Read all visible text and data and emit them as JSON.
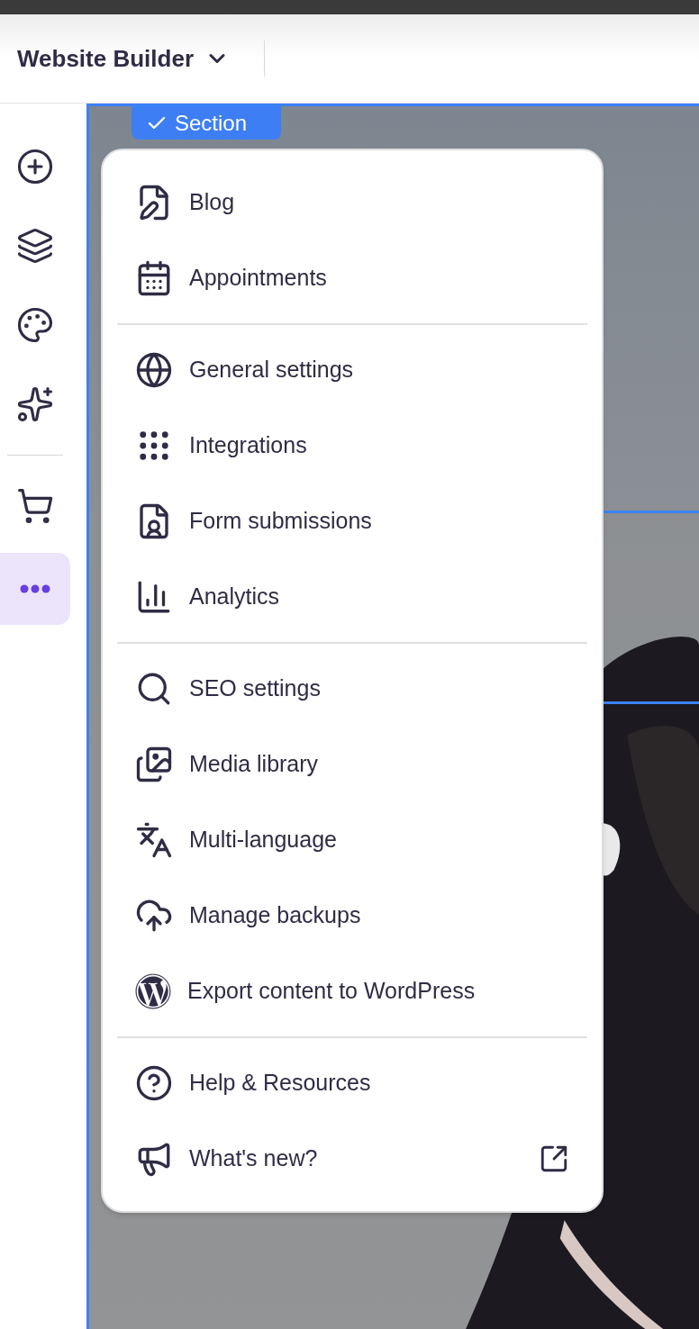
{
  "header": {
    "title": "Website Builder"
  },
  "sidebar": {
    "buttons": [
      {
        "selected": false
      },
      {
        "selected": false
      },
      {
        "selected": false
      },
      {
        "selected": false
      },
      {
        "selected": false
      },
      {
        "selected": true
      }
    ]
  },
  "canvas": {
    "section_badge": "Section"
  },
  "menu": {
    "groups": [
      {
        "items": [
          {
            "label": "Blog",
            "external": false
          },
          {
            "label": "Appointments",
            "external": false
          }
        ]
      },
      {
        "items": [
          {
            "label": "General settings",
            "external": false
          },
          {
            "label": "Integrations",
            "external": false
          },
          {
            "label": "Form submissions",
            "external": false
          },
          {
            "label": "Analytics",
            "external": false
          }
        ]
      },
      {
        "items": [
          {
            "label": "SEO settings",
            "external": false
          },
          {
            "label": "Media library",
            "external": false
          },
          {
            "label": "Multi-language",
            "external": false
          },
          {
            "label": "Manage backups",
            "external": false
          },
          {
            "label": "Export content to WordPress",
            "external": false
          }
        ]
      },
      {
        "items": [
          {
            "label": "Help & Resources",
            "external": false
          },
          {
            "label": "What's new?",
            "external": true
          }
        ]
      }
    ]
  }
}
